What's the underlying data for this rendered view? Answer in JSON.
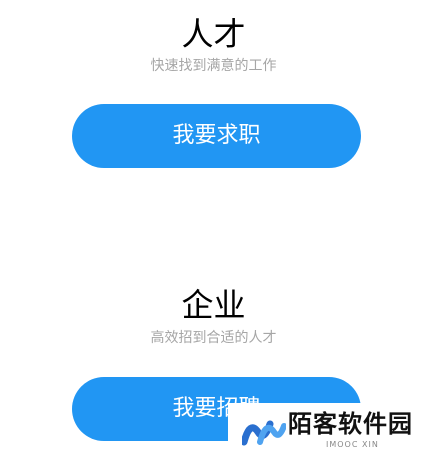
{
  "talent": {
    "title": "人才",
    "subtitle": "快速找到满意的工作",
    "button_label": "我要求职"
  },
  "company": {
    "title": "企业",
    "subtitle": "高效招到合适的人才",
    "button_label": "我要招聘"
  },
  "watermark": {
    "brand": "陌客软件园",
    "sub": "IMOOC XIN",
    "logo_icon": "wave-logo-icon"
  },
  "colors": {
    "accent": "#2196f3",
    "subtitle": "#a6a6a6"
  }
}
